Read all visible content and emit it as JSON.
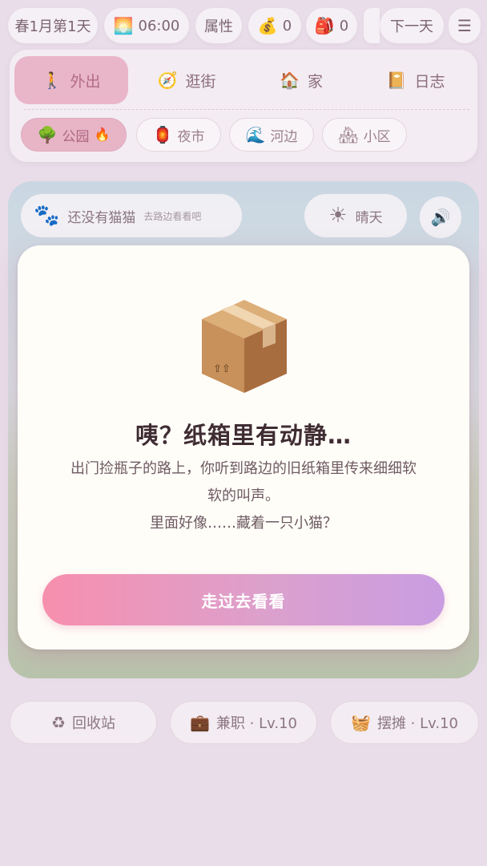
{
  "status_bar": {
    "date": "春1月第1天",
    "time": "06:00",
    "time_icon": "sunrise-icon",
    "attributes_label": "属性",
    "money_icon": "money-bag-icon",
    "money_count": "0",
    "bag_icon": "backpack-icon",
    "bag_count": "0",
    "next_day_label": "下一天",
    "menu_icon": "hamburger-menu-icon"
  },
  "main_tabs": [
    {
      "label": "外出",
      "icon": "walking-person-icon",
      "active": true
    },
    {
      "label": "逛街",
      "icon": "compass-icon",
      "active": false
    },
    {
      "label": "家",
      "icon": "house-icon",
      "active": false
    },
    {
      "label": "日志",
      "icon": "notebook-icon",
      "active": false
    }
  ],
  "sub_tabs": [
    {
      "label": "公园",
      "icon": "tree-icon",
      "badge_icon": "fire-icon",
      "active": true
    },
    {
      "label": "夜市",
      "icon": "lantern-icon",
      "active": false
    },
    {
      "label": "河边",
      "icon": "wave-icon",
      "active": false
    },
    {
      "label": "小区",
      "icon": "houses-icon",
      "active": false
    }
  ],
  "scene": {
    "cat_status": "还没有猫猫",
    "cat_hint": "去路边看看吧",
    "weather": "晴天",
    "weather_icon": "sun-icon",
    "sound_icon": "speaker-icon"
  },
  "modal": {
    "icon": "cardboard-box-icon",
    "title": "咦？纸箱里有动静…",
    "body_line1": "出门捡瓶子的路上，你听到路边的旧纸箱里传来细细软",
    "body_line2": "软的叫声。",
    "body_line3": "里面好像……藏着一只小猫？",
    "button_label": "走过去看看"
  },
  "bottom_actions": [
    {
      "label": "回收站",
      "icon": "recycle-icon"
    },
    {
      "label": "兼职 · Lv.10",
      "icon": "briefcase-icon"
    },
    {
      "label": "摆摊 · Lv.10",
      "icon": "basket-icon"
    }
  ],
  "colors": {
    "accent_pink": "#f78fae",
    "accent_purple": "#c99de2",
    "modal_bg": "#fffdf8",
    "title_text": "#3f2c33"
  }
}
